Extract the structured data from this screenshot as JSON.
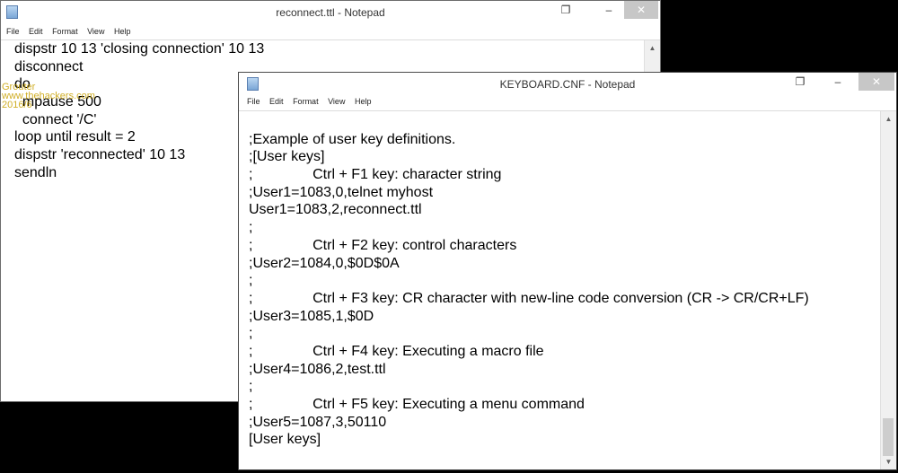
{
  "window1": {
    "title": "reconnect.ttl - Notepad",
    "controls": {
      "minimize": "–",
      "restore": "❐",
      "close": "✕"
    },
    "menu": [
      "File",
      "Edit",
      "Format",
      "View",
      "Help"
    ],
    "lines": [
      "dispstr 10 13 'closing connection' 10 13",
      "disconnect",
      "do",
      "  mpause 500",
      "  connect '/C'",
      "loop until result = 2",
      "dispstr 'reconnected' 10 13",
      "sendln"
    ]
  },
  "window2": {
    "title": "KEYBOARD.CNF - Notepad",
    "controls": {
      "minimize": "–",
      "restore": "❐",
      "close": "✕"
    },
    "menu": [
      "File",
      "Edit",
      "Format",
      "View",
      "Help"
    ],
    "lines": [
      "",
      ";Example of user key definitions.",
      ";[User keys]",
      ";\t\tCtrl + F1 key: character string",
      ";User1=1083,0,telnet myhost",
      "User1=1083,2,reconnect.ttl",
      ";",
      ";\t\tCtrl + F2 key: control characters",
      ";User2=1084,0,$0D$0A",
      ";",
      ";\t\tCtrl + F3 key: CR character with new-line code conversion (CR -> CR/CR+LF)",
      ";User3=1085,1,$0D",
      ";",
      ";\t\tCtrl + F4 key: Executing a macro file",
      ";User4=1086,2,test.ttl",
      ";",
      ";\t\tCtrl + F5 key: Executing a menu command",
      ";User5=1087,3,50110",
      "[User keys]"
    ]
  },
  "watermark": [
    "Grouter",
    "www.thehackers.com",
    "2016/6"
  ]
}
